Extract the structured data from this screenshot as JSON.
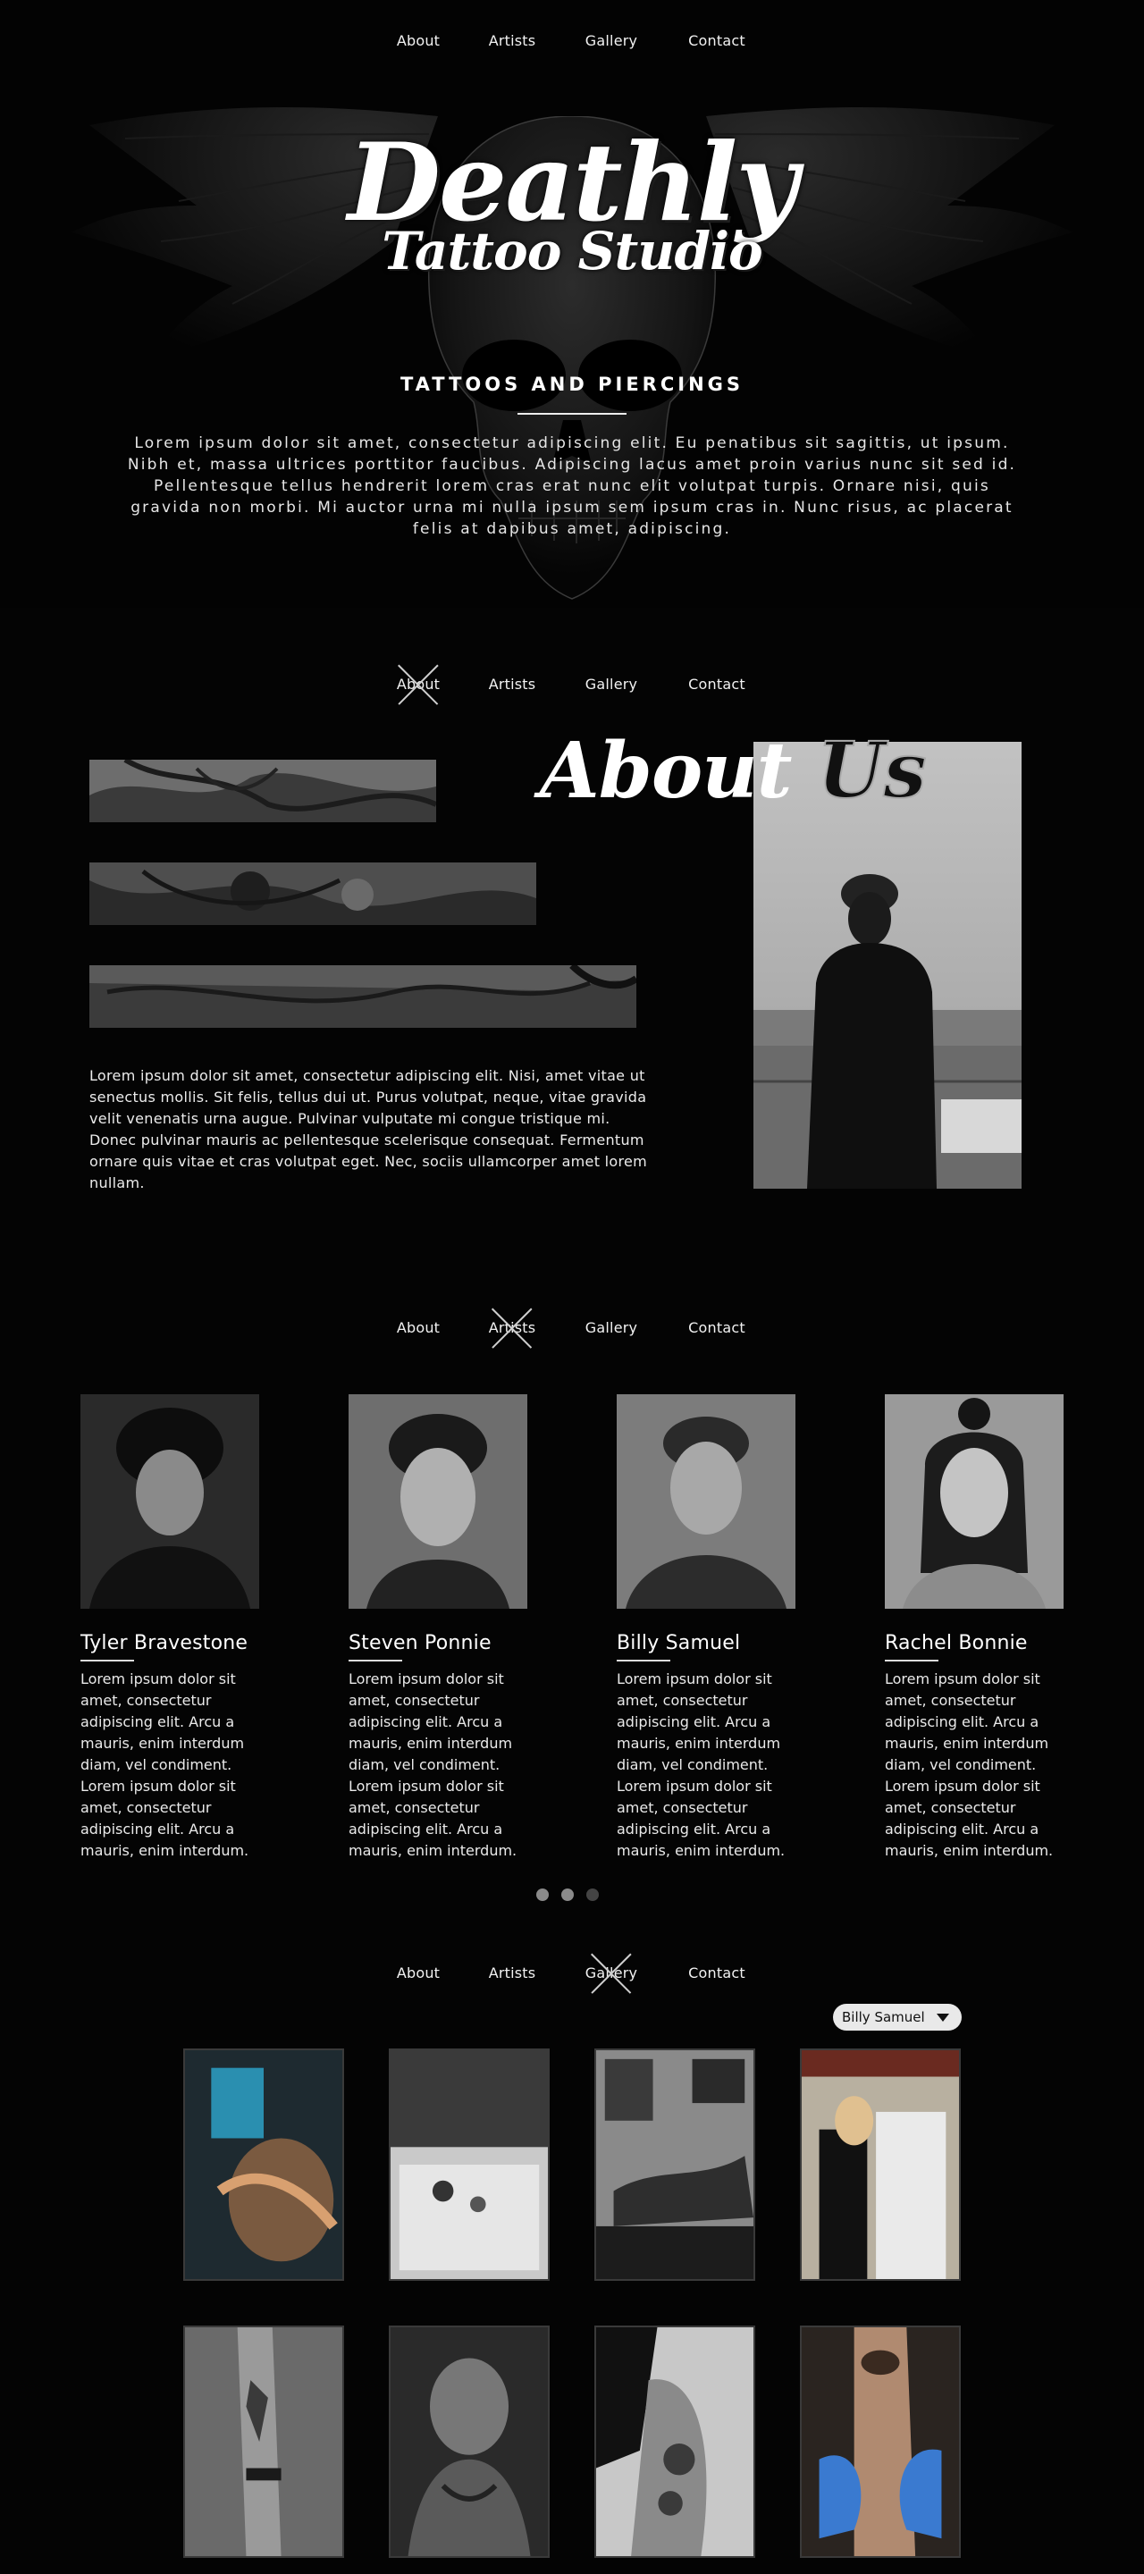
{
  "nav": {
    "about": "About",
    "artists": "Artists",
    "gallery": "Gallery",
    "contact": "Contact"
  },
  "hero": {
    "logo_main": "Deathly",
    "logo_sub": "Tattoo Studio",
    "tagline": "TATTOOS AND PIERCINGS",
    "text": "Lorem ipsum dolor sit amet, consectetur adipiscing elit. Eu penatibus sit sagittis, ut ipsum. Nibh et, massa ultrices porttitor faucibus. Adipiscing lacus amet proin varius nunc sit sed id. Pellentesque tellus hendrerit lorem cras erat nunc elit volutpat turpis. Ornare nisi, quis gravida non morbi. Mi auctor urna mi nulla ipsum sem ipsum cras in. Nunc risus, ac placerat felis at dapibus amet, adipiscing."
  },
  "about": {
    "title_a": "About",
    "title_b": "Us",
    "text": "Lorem ipsum dolor sit amet, consectetur adipiscing elit. Nisi, amet vitae ut senectus mollis. Sit felis, tellus dui ut. Purus volutpat, neque, vitae gravida velit venenatis urna augue. Pulvinar vulputate mi congue tristique mi. Donec pulvinar mauris ac pellentesque scelerisque consequat. Fermentum ornare quis vitae et cras volutpat eget. Nec, sociis ullamcorper amet lorem nullam."
  },
  "artists": [
    {
      "name": "Tyler Bravestone",
      "desc": "Lorem ipsum dolor sit amet, consectetur adipiscing elit. Arcu a mauris, enim interdum diam, vel condiment. Lorem ipsum dolor sit amet, consectetur adipiscing elit. Arcu a mauris, enim interdum."
    },
    {
      "name": "Steven Ponnie",
      "desc": "Lorem ipsum dolor sit amet, consectetur adipiscing elit. Arcu a mauris, enim interdum diam, vel condiment. Lorem ipsum dolor sit amet, consectetur adipiscing elit. Arcu a mauris, enim interdum."
    },
    {
      "name": "Billy Samuel",
      "desc": "Lorem ipsum dolor sit amet, consectetur adipiscing elit. Arcu a mauris, enim interdum diam, vel condiment. Lorem ipsum dolor sit amet, consectetur adipiscing elit. Arcu a mauris, enim interdum."
    },
    {
      "name": "Rachel Bonnie",
      "desc": "Lorem ipsum dolor sit amet, consectetur adipiscing elit. Arcu a mauris, enim interdum diam, vel condiment. Lorem ipsum dolor sit amet, consectetur adipiscing elit. Arcu a mauris, enim interdum."
    }
  ],
  "carousel": {
    "active_index": 1,
    "total": 3
  },
  "gallery": {
    "filter_selected": "Billy Samuel"
  },
  "icons": {
    "dropdown": "chevron-down-icon"
  }
}
